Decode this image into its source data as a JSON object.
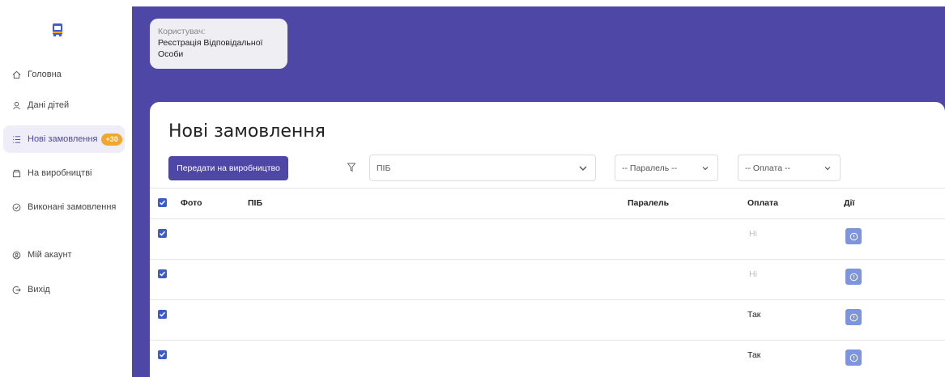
{
  "sidebar": {
    "logo_icon": "bus-icon",
    "items": [
      {
        "label": "Головна",
        "icon": "home-icon"
      },
      {
        "label": "Дані дітей",
        "icon": "user-icon"
      },
      {
        "label": "Нові замовлення",
        "icon": "list-icon",
        "badge": "+30"
      },
      {
        "label": "На виробництві",
        "icon": "box-icon"
      },
      {
        "label": "Виконані замовлення",
        "icon": "check-circle-icon"
      },
      {
        "label": "Мій акаунт",
        "icon": "account-icon"
      },
      {
        "label": "Вихід",
        "icon": "logout-icon"
      }
    ]
  },
  "user_card": {
    "label": "Користувач:",
    "name": "Реєстрація Відповідальної Особи"
  },
  "page": {
    "title": "Нові замовлення",
    "primary_button": "Передати на виробництво",
    "filters": {
      "pib": "ПІБ",
      "paralel": "-- Паралель --",
      "oplata": "-- Оплата --"
    }
  },
  "table": {
    "headers": {
      "photo": "Фото",
      "pib": "ПІБ",
      "paralel": "Паралель",
      "oplata": "Оплата",
      "actions": "Дії"
    },
    "rows": [
      {
        "photo": "",
        "pib": "",
        "paralel": "",
        "oplata": "Ні",
        "checked": true
      },
      {
        "photo": "",
        "pib": "",
        "paralel": "",
        "oplata": "Ні",
        "checked": true
      },
      {
        "photo": "",
        "pib": "",
        "paralel": "",
        "oplata": "Так",
        "checked": true
      },
      {
        "photo": "",
        "pib": "",
        "paralel": "",
        "oplata": "Так",
        "checked": true
      }
    ]
  },
  "colors": {
    "brand": "#4f47a6",
    "badge": "#f4a62a",
    "checkbox": "#3b5bcc",
    "action": "#7c95dd"
  }
}
